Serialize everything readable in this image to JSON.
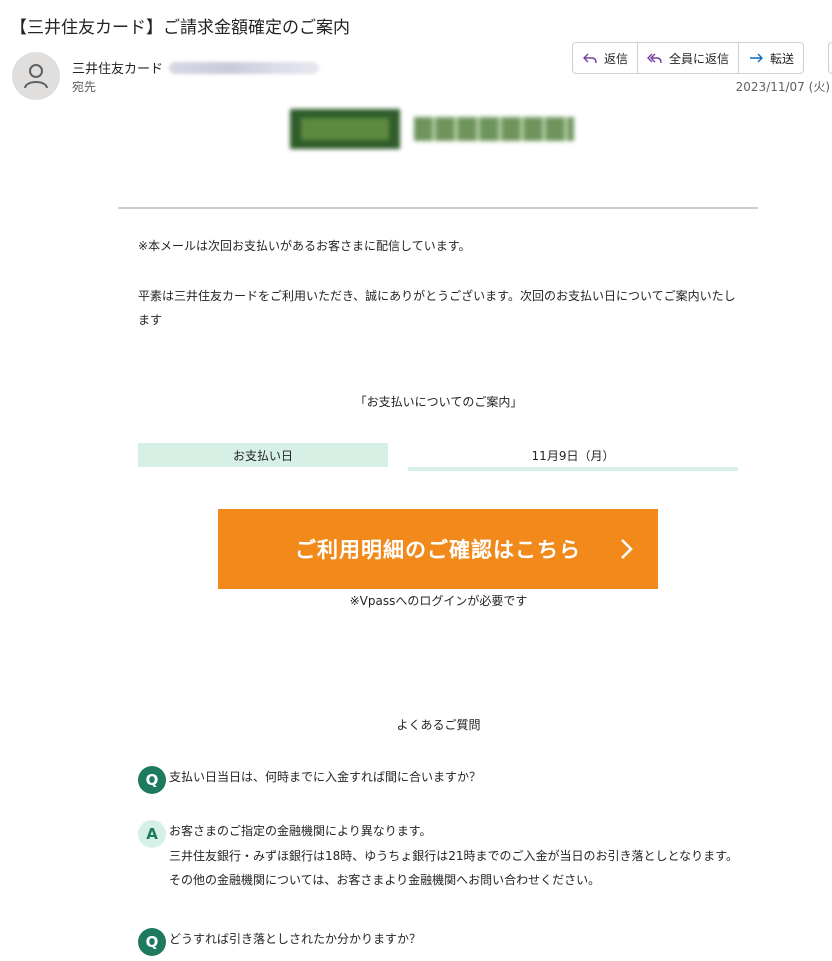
{
  "email": {
    "subject": "【三井住友カード】ご請求金額確定のご案内",
    "sender_name": "三井住友カード",
    "recipient_label": "宛先",
    "date": "2023/11/07 (火)",
    "actions": {
      "reply": "返信",
      "reply_all": "全員に返信",
      "forward": "転送"
    }
  },
  "body": {
    "notice": "※本メールは次回お支払いがあるお客さまに配信しています。",
    "intro": "平素は三井住友カードをご利用いただき、誠にありがとうございます。次回のお支払い日についてご案内いたします",
    "guide_heading": "「お支払いについてのご案内」",
    "payment_date_label": "お支払い日",
    "payment_date_value": "11月9日（月）",
    "cta_label": "ご利用明細のご確認はこちら",
    "cta_note": "※Vpassへのログインが必要です",
    "faq_heading": "よくあるご質問",
    "faq": [
      {
        "q_badge": "Q",
        "question": "支払い日当日は、何時までに入金すれば間に合いますか？",
        "a_badge": "A",
        "answer_lines": [
          "お客さまのご指定の金融機関により異なります。",
          "三井住友銀行・みずほ銀行は18時、ゆうちょ銀行は21時までのご入金が当日のお引き落としとなります。",
          "その他の金融機関については、お客さまより金融機関へお問い合わせください。"
        ]
      },
      {
        "q_badge": "Q",
        "question": "どうすれば引き落としされたか分かりますか？"
      }
    ]
  },
  "colors": {
    "accent_orange": "#f28a1b",
    "badge_green": "#1e7a5e",
    "light_mint": "#d7f0e6",
    "action_icon_purple": "#7b3fa1",
    "forward_icon_blue": "#0f6cbd"
  },
  "icons": {
    "avatar": "person-icon",
    "reply": "reply-icon",
    "reply_all": "reply-all-icon",
    "forward": "forward-arrow-icon",
    "cta": "chevron-right-icon"
  }
}
